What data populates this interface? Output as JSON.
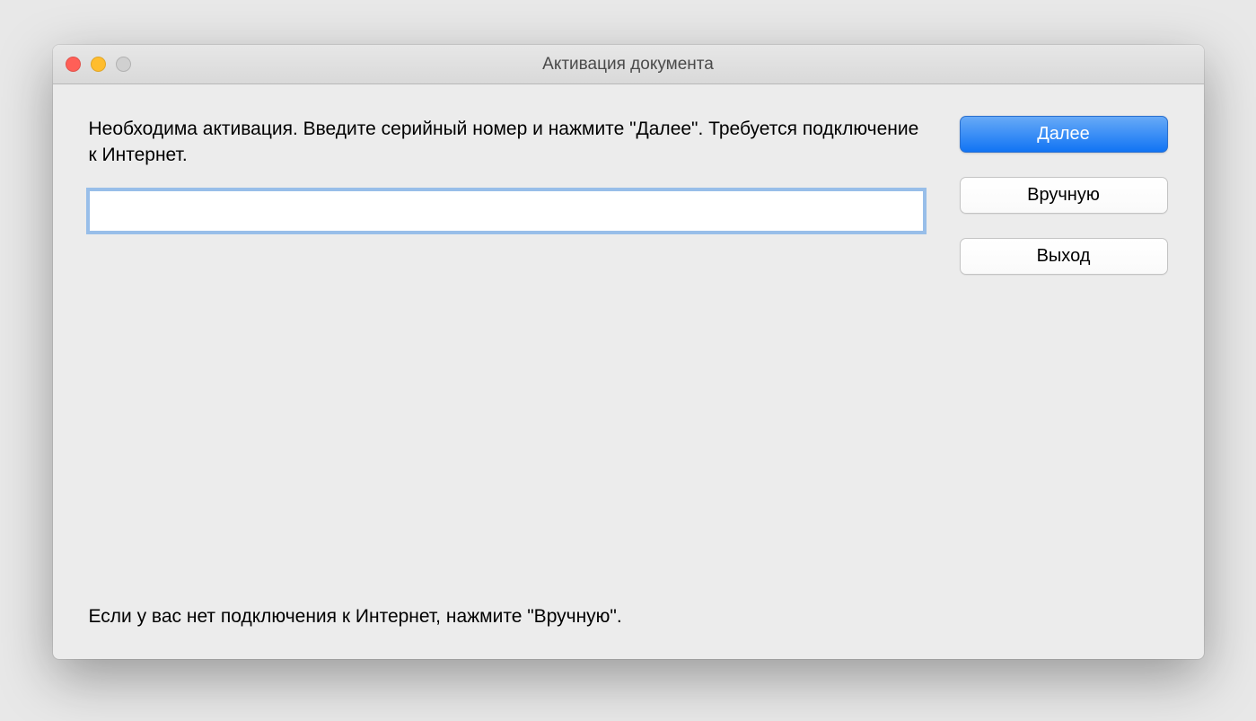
{
  "window": {
    "title": "Активация документа"
  },
  "main": {
    "instructions": "Необходима активация. Введите серийный номер и нажмите \"Далее\". Требуется подключение к Интернет.",
    "serial_value": "",
    "footer": "Если у вас нет подключения к Интернет, нажмите \"Вручную\"."
  },
  "buttons": {
    "next": "Далее",
    "manual": "Вручную",
    "exit": "Выход"
  }
}
